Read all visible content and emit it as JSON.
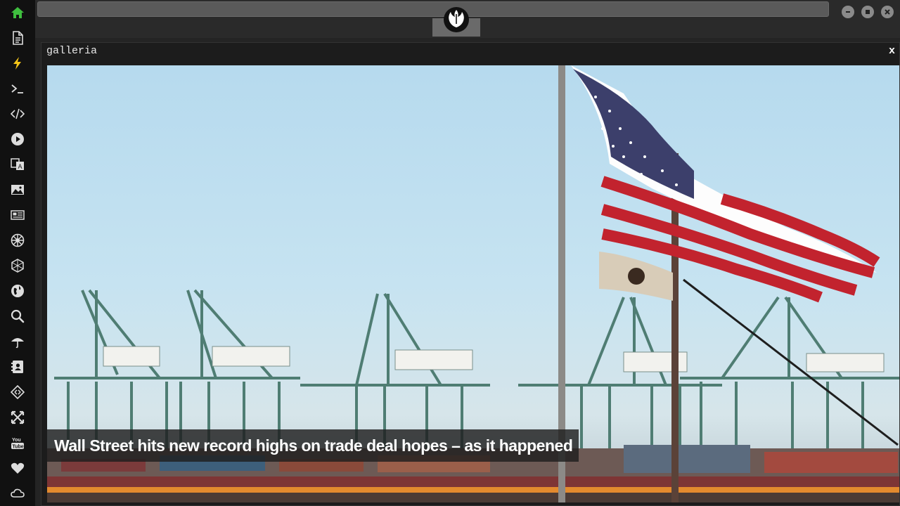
{
  "window": {
    "controls": [
      "minimize-icon",
      "maximize-icon",
      "close-icon"
    ]
  },
  "sidebar": {
    "items": [
      {
        "icon": "home-icon",
        "color": "#3fbf3f"
      },
      {
        "icon": "document-icon"
      },
      {
        "icon": "lightning-icon",
        "color": "#f5c518"
      },
      {
        "icon": "terminal-icon"
      },
      {
        "icon": "code-icon"
      },
      {
        "icon": "play-icon"
      },
      {
        "icon": "translate-icon"
      },
      {
        "icon": "image-icon"
      },
      {
        "icon": "newspaper-icon"
      },
      {
        "icon": "empire-icon"
      },
      {
        "icon": "hexagon-icon"
      },
      {
        "icon": "globe-icon"
      },
      {
        "icon": "search-icon"
      },
      {
        "icon": "umbrella-icon"
      },
      {
        "icon": "contacts-icon"
      },
      {
        "icon": "transfer-icon"
      },
      {
        "icon": "expand-icon"
      },
      {
        "icon": "youtube-icon"
      },
      {
        "icon": "heart-icon"
      },
      {
        "icon": "cloud-icon"
      }
    ]
  },
  "header": {
    "logo": "rebel-alliance-icon"
  },
  "panel": {
    "title": "galleria",
    "close_label": "x"
  },
  "gallery": {
    "caption": "Wall Street hits new record highs on trade deal hopes – as it happened"
  }
}
